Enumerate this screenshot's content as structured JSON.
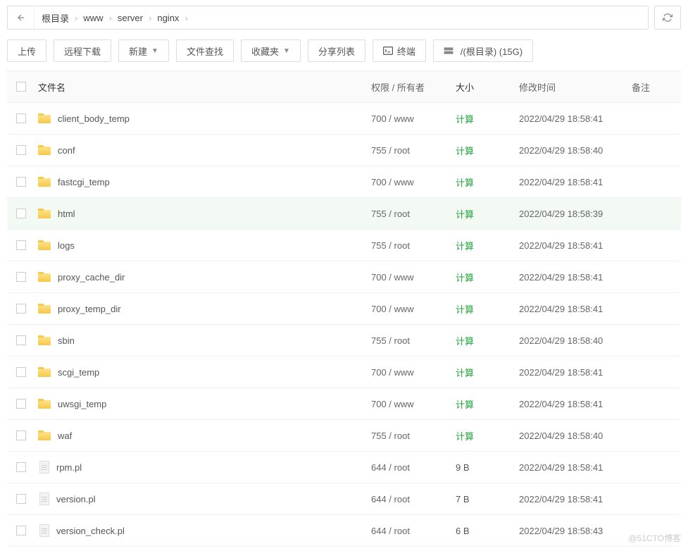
{
  "breadcrumb": [
    "根目录",
    "www",
    "server",
    "nginx"
  ],
  "toolbar": {
    "upload": "上传",
    "remote": "远程下载",
    "new": "新建",
    "search": "文件查找",
    "fav": "收藏夹",
    "share": "分享列表",
    "terminal": "终端",
    "disk": "/(根目录) (15G)"
  },
  "columns": {
    "name": "文件名",
    "perm": "权限 / 所有者",
    "size": "大小",
    "mtime": "修改时间",
    "note": "备注"
  },
  "rows": [
    {
      "type": "folder",
      "name": "client_body_temp",
      "perm": "700 / www",
      "size": "计算",
      "sizeLink": true,
      "mtime": "2022/04/29 18:58:41",
      "hl": false
    },
    {
      "type": "folder",
      "name": "conf",
      "perm": "755 / root",
      "size": "计算",
      "sizeLink": true,
      "mtime": "2022/04/29 18:58:40",
      "hl": false
    },
    {
      "type": "folder",
      "name": "fastcgi_temp",
      "perm": "700 / www",
      "size": "计算",
      "sizeLink": true,
      "mtime": "2022/04/29 18:58:41",
      "hl": false
    },
    {
      "type": "folder",
      "name": "html",
      "perm": "755 / root",
      "size": "计算",
      "sizeLink": true,
      "mtime": "2022/04/29 18:58:39",
      "hl": true
    },
    {
      "type": "folder",
      "name": "logs",
      "perm": "755 / root",
      "size": "计算",
      "sizeLink": true,
      "mtime": "2022/04/29 18:58:41",
      "hl": false
    },
    {
      "type": "folder",
      "name": "proxy_cache_dir",
      "perm": "700 / www",
      "size": "计算",
      "sizeLink": true,
      "mtime": "2022/04/29 18:58:41",
      "hl": false
    },
    {
      "type": "folder",
      "name": "proxy_temp_dir",
      "perm": "700 / www",
      "size": "计算",
      "sizeLink": true,
      "mtime": "2022/04/29 18:58:41",
      "hl": false
    },
    {
      "type": "folder",
      "name": "sbin",
      "perm": "755 / root",
      "size": "计算",
      "sizeLink": true,
      "mtime": "2022/04/29 18:58:40",
      "hl": false
    },
    {
      "type": "folder",
      "name": "scgi_temp",
      "perm": "700 / www",
      "size": "计算",
      "sizeLink": true,
      "mtime": "2022/04/29 18:58:41",
      "hl": false
    },
    {
      "type": "folder",
      "name": "uwsgi_temp",
      "perm": "700 / www",
      "size": "计算",
      "sizeLink": true,
      "mtime": "2022/04/29 18:58:41",
      "hl": false
    },
    {
      "type": "folder",
      "name": "waf",
      "perm": "755 / root",
      "size": "计算",
      "sizeLink": true,
      "mtime": "2022/04/29 18:58:40",
      "hl": false
    },
    {
      "type": "file",
      "name": "rpm.pl",
      "perm": "644 / root",
      "size": "9 B",
      "sizeLink": false,
      "mtime": "2022/04/29 18:58:41",
      "hl": false
    },
    {
      "type": "file",
      "name": "version.pl",
      "perm": "644 / root",
      "size": "7 B",
      "sizeLink": false,
      "mtime": "2022/04/29 18:58:41",
      "hl": false
    },
    {
      "type": "file",
      "name": "version_check.pl",
      "perm": "644 / root",
      "size": "6 B",
      "sizeLink": false,
      "mtime": "2022/04/29 18:58:43",
      "hl": false
    }
  ],
  "watermark": "@51CTO博客"
}
